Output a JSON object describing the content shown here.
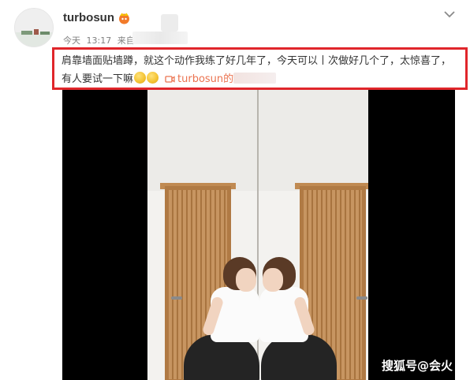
{
  "post": {
    "username": "turbosun",
    "badge_icon": "vip-crown-badge-icon",
    "meta": {
      "time_prefix": "今天",
      "time": "13:17",
      "source_prefix": "来自"
    },
    "content": {
      "text": "肩靠墙面贴墙蹲，就这个动作我练了好几年了，今天可以丨次做好几个了，太惊喜了，有人要试一下嘛",
      "emoji_icon": "laughing-emoji-icon",
      "video_link": "turbosun的"
    }
  },
  "video": {
    "watermark": "搜狐号@会火"
  },
  "colors": {
    "highlight_border": "#e0262b",
    "link": "#eb7350",
    "text": "#333333",
    "meta": "#808080"
  }
}
